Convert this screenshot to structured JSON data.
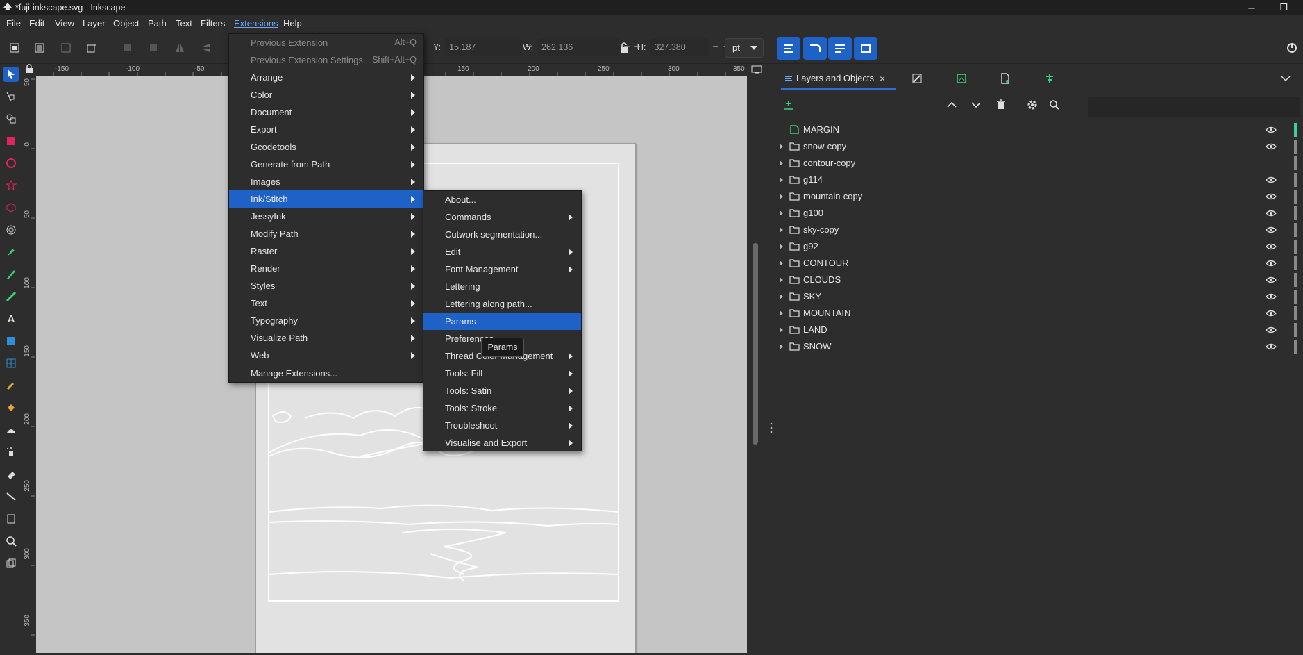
{
  "window": {
    "title": "*fuji-inkscape.svg - Inkscape",
    "minimize": "─",
    "maximize": "❐"
  },
  "menubar": [
    "File",
    "Edit",
    "View",
    "Layer",
    "Object",
    "Path",
    "Text",
    "Filters",
    "Extensions",
    "Help"
  ],
  "toolbar": {
    "y_label": "Y:",
    "y_value": "15.187",
    "w_label": "W:",
    "w_value": "262.136",
    "h_label": "H:",
    "h_value": "327.380",
    "unit": "pt"
  },
  "ruler": {
    "top": [
      "-150",
      "-100",
      "-50",
      "150",
      "200",
      "250",
      "300",
      "350"
    ],
    "left": [
      "50",
      "0",
      "50",
      "100",
      "150",
      "200",
      "250",
      "300",
      "350"
    ]
  },
  "extensions_menu": {
    "items": [
      {
        "label": "Previous Extension",
        "accel": "Alt+Q",
        "disabled": true
      },
      {
        "label": "Previous Extension Settings...",
        "accel": "Shift+Alt+Q",
        "disabled": true
      },
      {
        "label": "Arrange",
        "submenu": true
      },
      {
        "label": "Color",
        "submenu": true
      },
      {
        "label": "Document",
        "submenu": true
      },
      {
        "label": "Export",
        "submenu": true
      },
      {
        "label": "Gcodetools",
        "submenu": true
      },
      {
        "label": "Generate from Path",
        "submenu": true
      },
      {
        "label": "Images",
        "submenu": true
      },
      {
        "label": "Ink/Stitch",
        "submenu": true,
        "highlighted": true
      },
      {
        "label": "JessyInk",
        "submenu": true
      },
      {
        "label": "Modify Path",
        "submenu": true
      },
      {
        "label": "Raster",
        "submenu": true
      },
      {
        "label": "Render",
        "submenu": true
      },
      {
        "label": "Styles",
        "submenu": true
      },
      {
        "label": "Text",
        "submenu": true
      },
      {
        "label": "Typography",
        "submenu": true
      },
      {
        "label": "Visualize Path",
        "submenu": true
      },
      {
        "label": "Web",
        "submenu": true
      },
      {
        "label": "Manage Extensions..."
      }
    ]
  },
  "inkstitch_menu": {
    "items": [
      {
        "label": "About..."
      },
      {
        "label": "Commands",
        "submenu": true
      },
      {
        "label": "Cutwork segmentation..."
      },
      {
        "label": "Edit",
        "submenu": true
      },
      {
        "label": "Font Management",
        "submenu": true
      },
      {
        "label": "Lettering"
      },
      {
        "label": "Lettering along path..."
      },
      {
        "label": "Params",
        "highlighted": true
      },
      {
        "label": "Preferences"
      },
      {
        "label": "Thread Color Management",
        "submenu": true
      },
      {
        "label": "Tools: Fill",
        "submenu": true
      },
      {
        "label": "Tools: Satin",
        "submenu": true
      },
      {
        "label": "Tools: Stroke",
        "submenu": true
      },
      {
        "label": "Troubleshoot",
        "submenu": true
      },
      {
        "label": "Visualise and Export",
        "submenu": true
      }
    ]
  },
  "tooltip": "Params",
  "dock": {
    "active_tab": "Layers and Objects",
    "close": "×",
    "layers": [
      {
        "name": "MARGIN",
        "type": "object",
        "eye": true,
        "color": "#3ccfa4"
      },
      {
        "name": "snow-copy",
        "type": "group",
        "eye": true
      },
      {
        "name": "contour-copy",
        "type": "group",
        "eye": false
      },
      {
        "name": "g114",
        "type": "group",
        "eye": true
      },
      {
        "name": "mountain-copy",
        "type": "group",
        "eye": true
      },
      {
        "name": "g100",
        "type": "group",
        "eye": true
      },
      {
        "name": "sky-copy",
        "type": "group",
        "eye": true
      },
      {
        "name": "g92",
        "type": "group",
        "eye": true
      },
      {
        "name": "CONTOUR",
        "type": "group",
        "eye": true
      },
      {
        "name": "CLOUDS",
        "type": "group",
        "eye": true
      },
      {
        "name": "SKY",
        "type": "group",
        "eye": true
      },
      {
        "name": "MOUNTAIN",
        "type": "group",
        "eye": true
      },
      {
        "name": "LAND",
        "type": "group",
        "eye": true
      },
      {
        "name": "SNOW",
        "type": "group",
        "eye": true
      }
    ]
  },
  "colors": {
    "accent": "#1f62c7",
    "bg": "#2d2d2d",
    "canvas": "#c5c5c5",
    "page": "#e2e2e2"
  }
}
